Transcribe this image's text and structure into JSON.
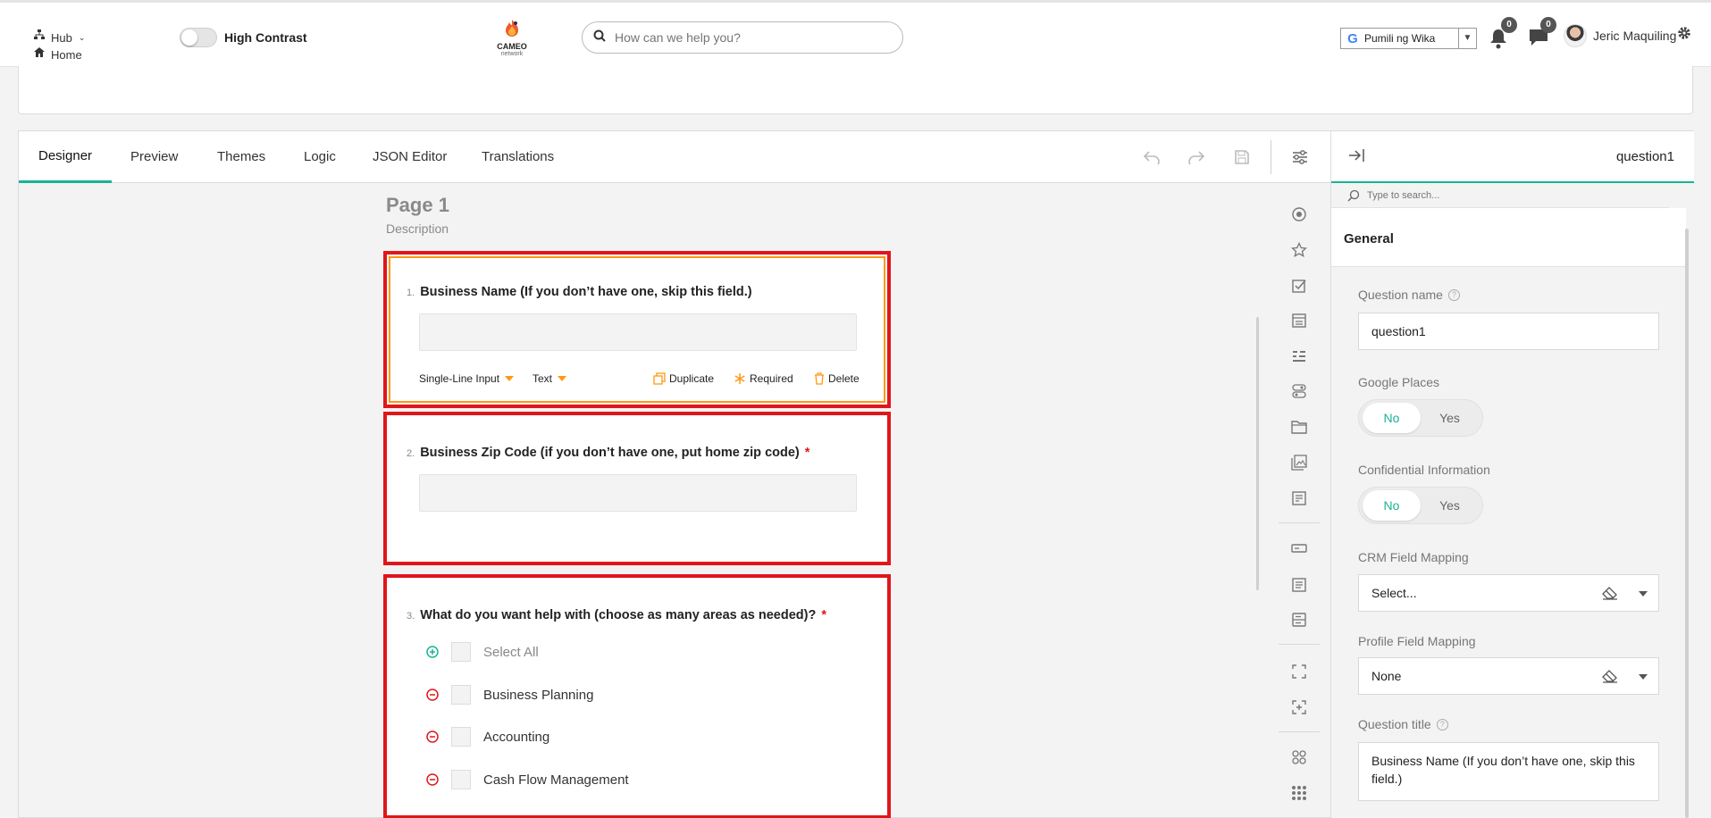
{
  "header": {
    "hub_label": "Hub",
    "home_label": "Home",
    "high_contrast_label": "High Contrast",
    "logo_text": "CAMEO",
    "logo_subtext": "network",
    "search_placeholder": "How can we help you?",
    "language_label": "Pumili ng Wika",
    "notifications_count": "0",
    "messages_count": "0",
    "user_name": "Jeric Maquiling"
  },
  "tabs": [
    "Designer",
    "Preview",
    "Themes",
    "Logic",
    "JSON Editor",
    "Translations"
  ],
  "page": {
    "title": "Page 1",
    "description": "Description"
  },
  "questions": [
    {
      "number": "1.",
      "title": "Business Name (If you don’t have one, skip this field.)",
      "input_type": "Single-Line Input",
      "value_type": "Text",
      "duplicate_label": "Duplicate",
      "required_label": "Required",
      "delete_label": "Delete"
    },
    {
      "number": "2.",
      "title": "Business Zip Code (if you don’t have one, put home zip code)",
      "required_mark": "*"
    },
    {
      "number": "3.",
      "title": "What do you want help with (choose as many areas as needed)?",
      "required_mark": "*",
      "choices": [
        "Select All",
        "Business Planning",
        "Accounting",
        "Cash Flow Management"
      ]
    }
  ],
  "panel": {
    "object_name": "question1",
    "search_placeholder": "Type to search...",
    "group_title": "General",
    "question_name_label": "Question name",
    "question_name_value": "question1",
    "google_places_label": "Google Places",
    "confidential_label": "Confidential Information",
    "no_label": "No",
    "yes_label": "Yes",
    "crm_label": "CRM Field Mapping",
    "crm_value": "Select...",
    "profile_label": "Profile Field Mapping",
    "profile_value": "None",
    "question_title_label": "Question title",
    "question_title_value": "Business Name (If you don’t have one, skip this field.)"
  },
  "colors": {
    "accent": "#19b394",
    "selection": "#ff9814",
    "highlight_border": "#e0161b"
  }
}
